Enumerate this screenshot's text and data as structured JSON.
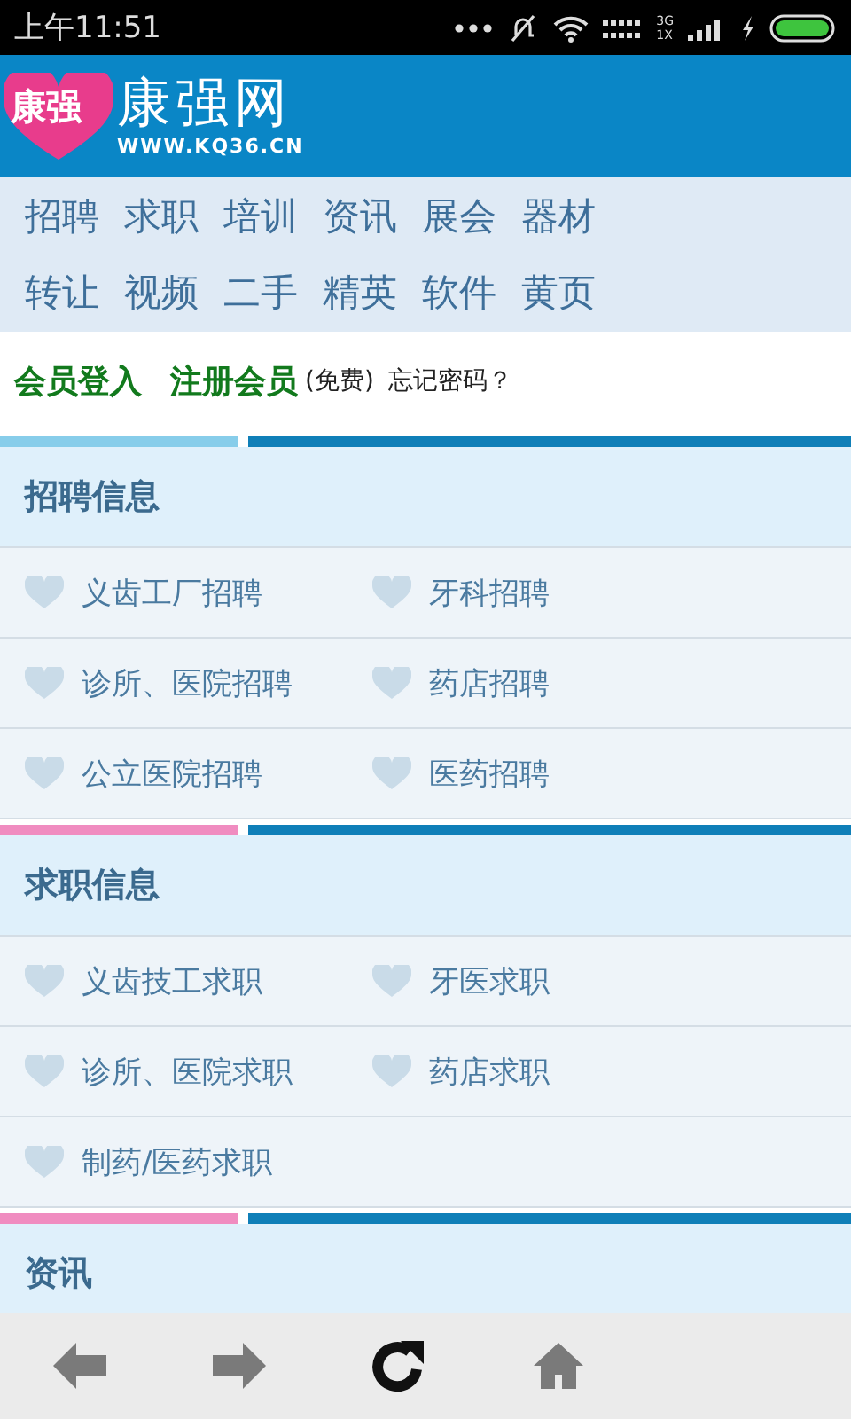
{
  "status_bar": {
    "time": "上午11:51",
    "network": "3G",
    "network_sub": "1X"
  },
  "header": {
    "logo_badge": "康强",
    "logo_title": "康强网",
    "logo_url": "WWW.KQ36.CN"
  },
  "nav": [
    "招聘",
    "求职",
    "培训",
    "资讯",
    "展会",
    "器材",
    "转让",
    "视频",
    "二手",
    "精英",
    "软件",
    "黄页"
  ],
  "login_bar": {
    "login": "会员登入",
    "register": "注册会员",
    "note": "(免费)",
    "forgot": "忘记密码？"
  },
  "sections": [
    {
      "title": "招聘信息",
      "color": "#87cdea",
      "items": [
        "义齿工厂招聘",
        "牙科招聘",
        "诊所、医院招聘",
        "药店招聘",
        "公立医院招聘",
        "医药招聘"
      ]
    },
    {
      "title": "求职信息",
      "color": "#f08cc0",
      "items": [
        "义齿技工求职",
        "牙医求职",
        "诊所、医院求职",
        "药店求职",
        "制药/医药求职"
      ]
    },
    {
      "title": "资讯",
      "color": "#f08cc0"
    }
  ],
  "toolbar": [
    {
      "kind": "back"
    },
    {
      "kind": "forward"
    },
    {
      "kind": "refresh"
    },
    {
      "kind": "home"
    }
  ]
}
